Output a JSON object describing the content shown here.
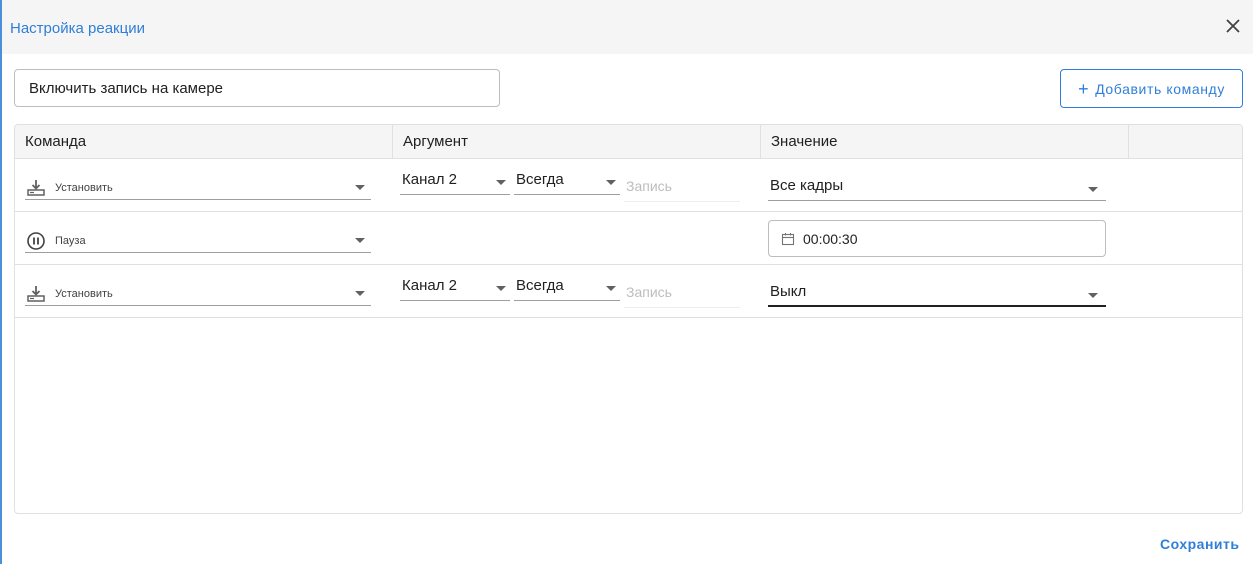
{
  "dialog": {
    "title": "Настройка реакции",
    "close_icon": "close-icon",
    "accent_color": "#2f7fd8"
  },
  "name_field": {
    "value": "Включить запись на камере"
  },
  "add_button": {
    "icon": "plus-icon",
    "label": "Добавить команду"
  },
  "table": {
    "columns": [
      "Команда",
      "Аргумент",
      "Значение",
      ""
    ],
    "rows": [
      {
        "command": {
          "icon": "download-set-icon",
          "label": "Установить"
        },
        "argument": {
          "channel": "Канал 2",
          "mode": "Всегда",
          "text_placeholder": "Запись"
        },
        "value": {
          "type": "select",
          "value": "Все кадры"
        }
      },
      {
        "command": {
          "icon": "pause-circle-icon",
          "label": "Пауза"
        },
        "argument": null,
        "value": {
          "type": "time",
          "icon": "calendar-icon",
          "value": "00:00:30"
        }
      },
      {
        "command": {
          "icon": "download-set-icon",
          "label": "Установить"
        },
        "argument": {
          "channel": "Канал 2",
          "mode": "Всегда",
          "text_placeholder": "Запись"
        },
        "value": {
          "type": "select",
          "value": "Выкл"
        }
      }
    ]
  },
  "footer": {
    "save_label": "Сохранить"
  }
}
